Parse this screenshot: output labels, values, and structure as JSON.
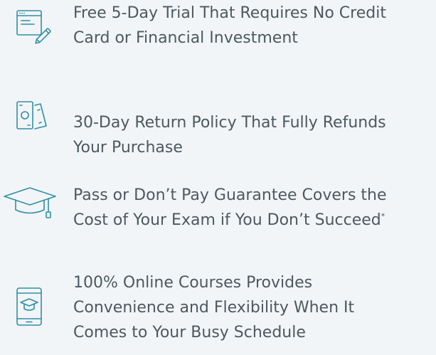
{
  "features": [
    {
      "icon": "browser-pencil-icon",
      "lines": [
        "Free 5-Day Trial That Requires No Credit",
        "Card or Financial Investment"
      ]
    },
    {
      "icon": "money-bills-icon",
      "lines": [
        "30-Day Return Policy That Fully Refunds",
        "Your Purchase"
      ]
    },
    {
      "icon": "graduation-cap-icon",
      "lines": [
        "Pass or Don’t Pay Guarantee Covers the",
        "Cost of Your Exam if You Don’t Succeed"
      ],
      "footnote_mark": "*"
    },
    {
      "icon": "mobile-graduation-cap-icon",
      "lines": [
        "100% Online Courses Provides",
        "Convenience and Flexibility When It",
        "Comes to Your Busy Schedule"
      ]
    }
  ],
  "colors": {
    "background": "#f2f5f7",
    "text": "#4d5860",
    "icon_stroke": "#2f8fa8"
  }
}
